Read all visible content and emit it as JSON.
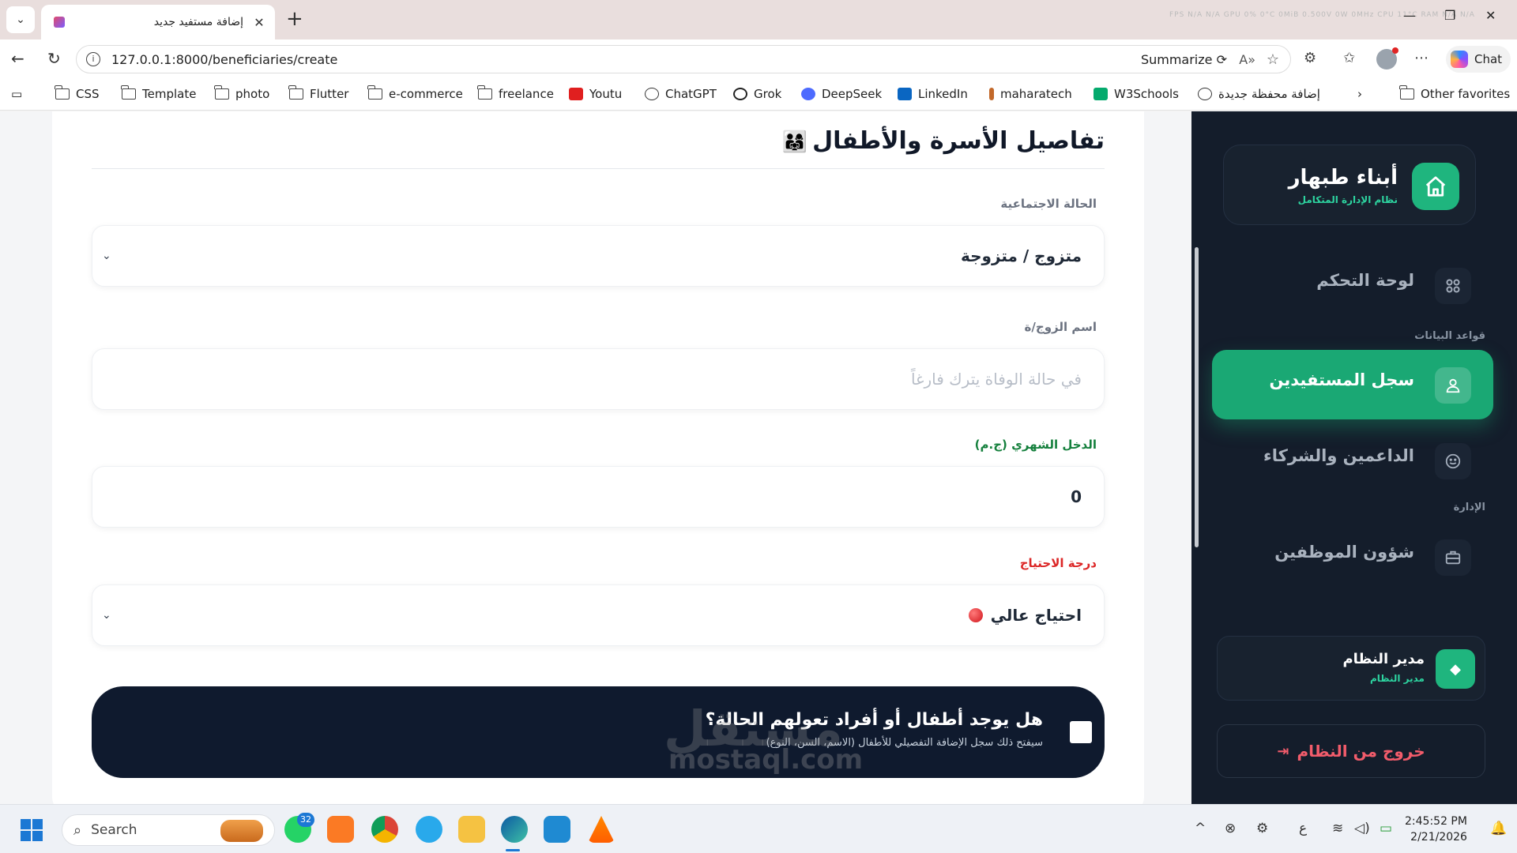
{
  "browser": {
    "tab_title": "إضافة مستفيد جديد",
    "url": "127.0.0.1:8000/beneficiaries/create",
    "summarize_label": "Summarize",
    "chat_label": "Chat",
    "perf_text": "FPS N/A N/A  GPU 0% 0°C 0MiB 0.500V 0W 0MHz  CPU 11°C  RAM N/A N/A"
  },
  "bookmarks": [
    {
      "label": "CSS",
      "icon": "folder-icon"
    },
    {
      "label": "Template",
      "icon": "folder-icon"
    },
    {
      "label": "photo",
      "icon": "folder-icon"
    },
    {
      "label": "Flutter",
      "icon": "folder-icon"
    },
    {
      "label": "e-commerce",
      "icon": "folder-icon"
    },
    {
      "label": "freelance",
      "icon": "folder-icon"
    },
    {
      "label": "Youtu",
      "icon": "youtube-icon"
    },
    {
      "label": "ChatGPT",
      "icon": "chatgpt-icon"
    },
    {
      "label": "Grok",
      "icon": "grok-icon"
    },
    {
      "label": "DeepSeek",
      "icon": "deepseek-icon"
    },
    {
      "label": "LinkedIn",
      "icon": "linkedin-icon"
    },
    {
      "label": "maharatech",
      "icon": "maharatech-icon"
    },
    {
      "label": "W3Schools",
      "icon": "w3schools-icon"
    },
    {
      "label": "إضافة محفظة جديدة",
      "icon": "globe-icon"
    },
    {
      "label": "Other favorites",
      "icon": "folder-icon"
    }
  ],
  "form": {
    "section_title": "تفاصيل الأسرة والأطفال",
    "section_emoji": "👨‍👩‍👧",
    "marital_label": "الحالة الاجتماعية",
    "marital_value": "متزوج / متزوجة",
    "spouse_label": "اسم الزوج/ة",
    "spouse_placeholder": "في حالة الوفاة يترك فارغاً",
    "income_label": "الدخل الشهري (ج.م)",
    "income_value": "0",
    "need_label": "درجة الاحتياج",
    "need_value": "احتياج عالي",
    "children_question": "هل يوجد أطفال أو أفراد تعولهم الحالة؟",
    "children_hint": "سيفتح ذلك سجل الإضافة التفصيلي للأطفال (الاسم، السن، النوع)"
  },
  "colors": {
    "income_label": "#15803d",
    "need_label": "#dc2626",
    "accent": "#1aa874",
    "sidebar_bg": "#141d2b"
  },
  "sidebar": {
    "brand_name": "أبناء طبهار",
    "brand_tagline": "نظام الإدارة المتكامل",
    "items": [
      {
        "label": "لوحة التحكم",
        "icon": "grid-icon"
      },
      {
        "label": "سجل المستفيدين",
        "icon": "users-icon",
        "active": true
      },
      {
        "label": "الداعمين والشركاء",
        "icon": "smile-icon"
      },
      {
        "label": "شؤون الموظفين",
        "icon": "briefcase-icon"
      }
    ],
    "group_databases": "قواعد البيانات",
    "group_admin": "الإدارة",
    "user_name": "مدير النظام",
    "user_role": "مدير النظام",
    "logout_label": "خروج من النظام"
  },
  "watermark": {
    "arabic": "مستقل",
    "latin": "mostaql.com"
  },
  "taskbar": {
    "search_placeholder": "Search",
    "whatsapp_badge": "32",
    "time": "2:45:52 PM",
    "date": "2/21/2026",
    "lang": "ع"
  }
}
